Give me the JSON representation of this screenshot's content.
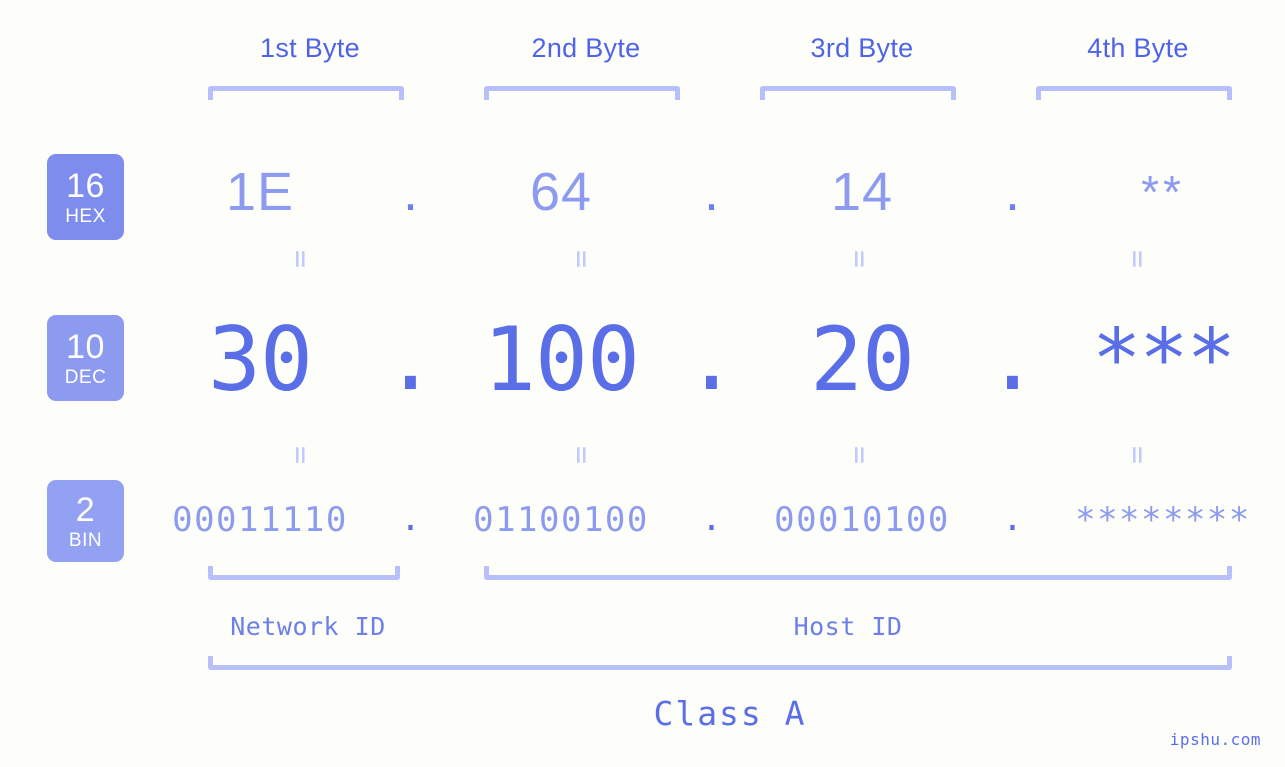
{
  "watermark": "ipshu.com",
  "byte_headers": [
    {
      "label": "1st Byte"
    },
    {
      "label": "2nd Byte"
    },
    {
      "label": "3rd Byte"
    },
    {
      "label": "4th Byte"
    }
  ],
  "radix_badges": [
    {
      "number": "16",
      "name": "HEX",
      "color": "#7d8ced"
    },
    {
      "number": "10",
      "name": "DEC",
      "color": "#8c9bf0"
    },
    {
      "number": "2",
      "name": "BIN",
      "color": "#93a1f2"
    }
  ],
  "separator": ".",
  "equals_glyph": "=",
  "rows": {
    "hex": {
      "radix": "16",
      "values": [
        "1E",
        "64",
        "14",
        "**"
      ],
      "masked_index": 3
    },
    "dec": {
      "radix": "10",
      "values": [
        "30",
        "100",
        "20",
        "***"
      ],
      "masked_index": 3
    },
    "bin": {
      "radix": "2",
      "values": [
        "00011110",
        "01100100",
        "00010100",
        "********"
      ],
      "masked_index": 3
    }
  },
  "ip_address": {
    "hex": "1E.64.14.**",
    "dec": "30.100.20.***",
    "bin": "00011110.01100100.00010100.********"
  },
  "sections": {
    "network_id": "Network ID",
    "host_id": "Host ID",
    "class": "Class A"
  },
  "colors": {
    "background": "#fdfefa",
    "accent_dark": "#4f63e8",
    "accent_mid": "#5a6ee8",
    "accent_light": "#8c9bf0",
    "bracket": "#b7c0fb",
    "equals": "#c2c9fb"
  }
}
